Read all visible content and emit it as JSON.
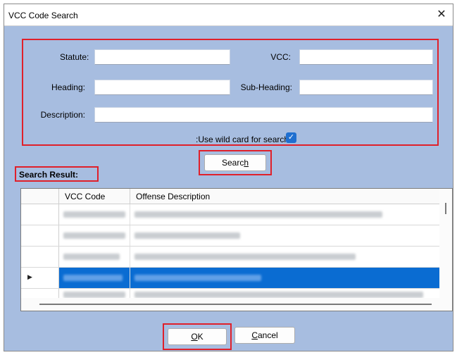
{
  "window": {
    "title": "VCC Code Search",
    "close_glyph": "✕"
  },
  "criteria": {
    "statute_label": "Statute:",
    "statute_value": "",
    "vcc_label": "VCC:",
    "vcc_value": "",
    "heading_label": "Heading:",
    "heading_value": "",
    "subheading_label": "Sub-Heading:",
    "subheading_value": "",
    "description_label": "Description:",
    "description_value": "",
    "wildcard_label": ":Use wild card for search",
    "wildcard_checked": true
  },
  "search_button": {
    "label_pre": "Searc",
    "label_mnemonic": "h",
    "label_post": ""
  },
  "results": {
    "title": "Search Result:",
    "columns": [
      "VCC Code",
      "Offense Description"
    ],
    "selected_row_index": 3,
    "row_count": 5
  },
  "ok_button": {
    "label_pre": "",
    "label_mnemonic": "O",
    "label_post": "K"
  },
  "cancel_button": {
    "label_pre": "",
    "label_mnemonic": "C",
    "label_post": "ancel"
  },
  "colors": {
    "highlight_red": "#e0202a",
    "dialog_bg": "#a7bde0",
    "selection": "#0a6cd2",
    "checkbox": "#1f6fd0"
  }
}
